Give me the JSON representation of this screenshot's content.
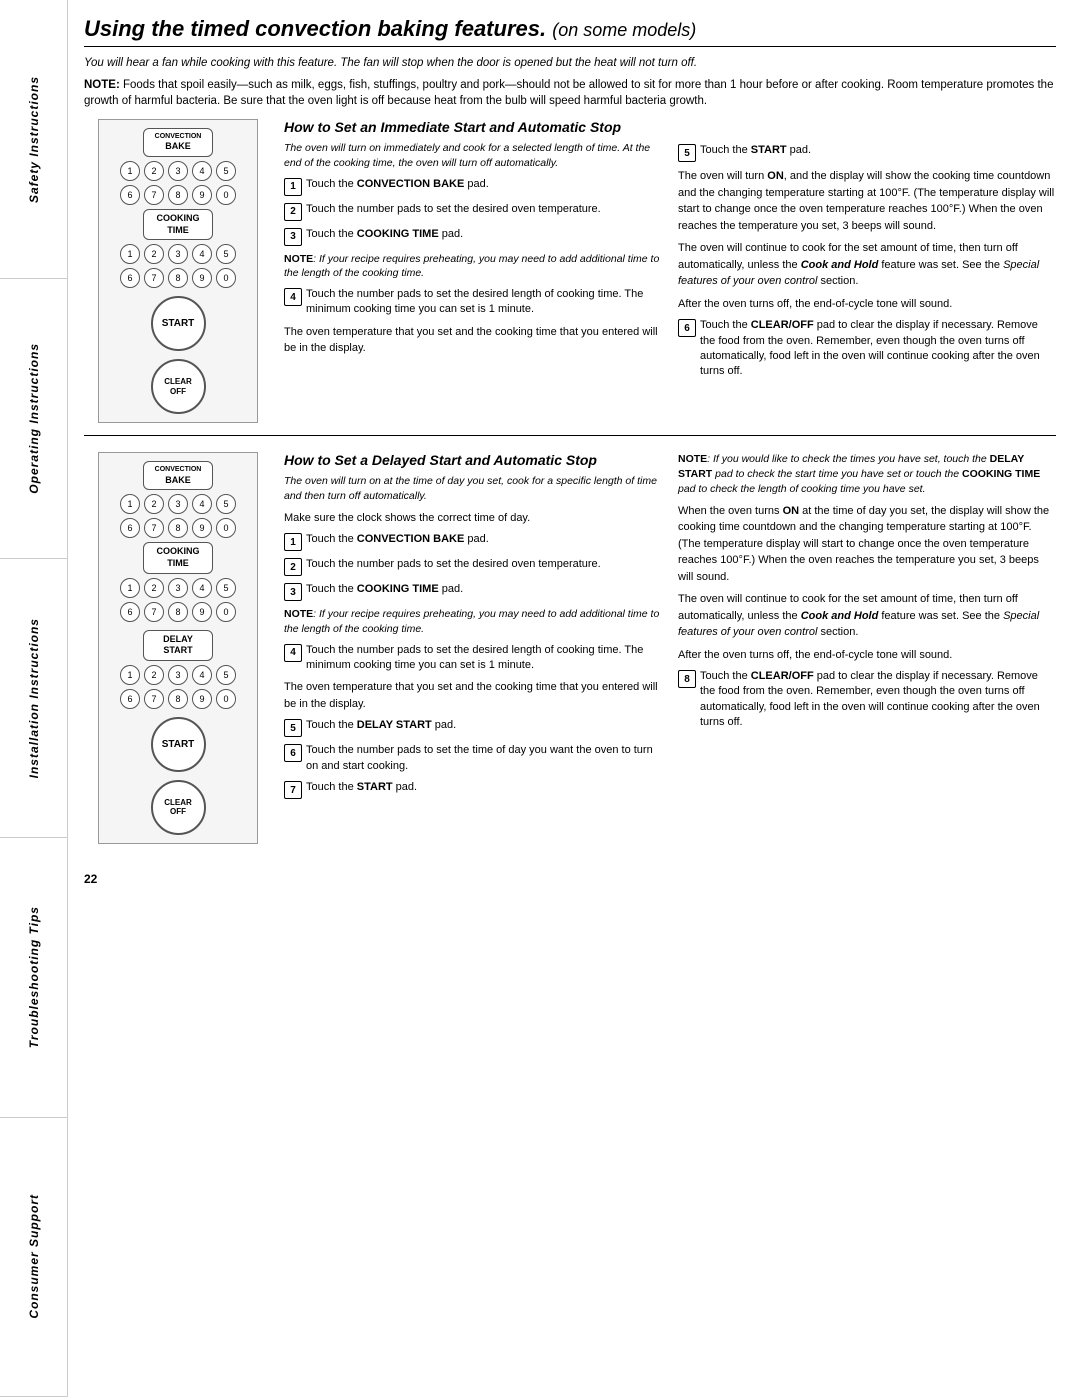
{
  "sidebar": {
    "sections": [
      {
        "label": "Safety Instructions"
      },
      {
        "label": "Operating Instructions"
      },
      {
        "label": "Installation Instructions"
      },
      {
        "label": "Troubleshooting Tips"
      },
      {
        "label": "Consumer Support"
      }
    ]
  },
  "page": {
    "title": "Using the timed convection baking features.",
    "subtitle": "(on some models)",
    "intro": "You will hear a fan while cooking with this feature. The fan will stop when the door is opened but the heat will not turn off.",
    "note": "NOTE: Foods that spoil easily—such as milk, eggs, fish, stuffings, poultry and pork—should not be allowed to sit for more than 1 hour before or after cooking. Room temperature promotes the growth of harmful bacteria. Be sure that the oven light is off because heat from the bulb will speed harmful bacteria growth.",
    "page_number": "22"
  },
  "section1": {
    "heading": "How to Set an Immediate Start and Automatic Stop",
    "italic_intro": "The oven will turn on immediately and cook for a selected length of time. At the end of the cooking time, the oven will turn off automatically.",
    "steps_left": [
      {
        "num": "1",
        "text": "Touch the CONVECTION BAKE pad."
      },
      {
        "num": "2",
        "text": "Touch the number pads to set the desired oven temperature."
      },
      {
        "num": "3",
        "text": "Touch the COOKING TIME pad."
      },
      {
        "num": "4",
        "text": "Touch the number pads to set the desired length of cooking time. The minimum cooking time you can set is 1 minute."
      }
    ],
    "note_left": "NOTE: If your recipe requires preheating, you may need to add additional time to the length of the cooking time.",
    "display_text": "The oven temperature that you set and the cooking time that you entered will be in the display.",
    "steps_right": [
      {
        "num": "5",
        "text": "Touch the START pad."
      }
    ],
    "body_right": [
      "The oven will turn ON, and the display will show the cooking time countdown and the changing temperature starting at 100°F. (The temperature display will start to change once the oven temperature reaches 100°F.) When the oven reaches the temperature you set, 3 beeps will sound.",
      "The oven will continue to cook for the set amount of time, then turn off automatically, unless the Cook and Hold feature was set. See the Special features of your oven control section.",
      "After the oven turns off, the end-of-cycle tone will sound."
    ],
    "step6": {
      "num": "6",
      "text": "Touch the CLEAR/OFF pad to clear the display if necessary. Remove the food from the oven. Remember, even though the oven turns off automatically, food left in the oven will continue cooking after the oven turns off."
    },
    "panel": {
      "buttons": [
        "CONVECTION BAKE",
        "COOKING TIME",
        "START",
        "CLEAR OFF"
      ],
      "num_rows": [
        [
          "1",
          "2",
          "3",
          "4",
          "5"
        ],
        [
          "6",
          "7",
          "8",
          "9",
          "0"
        ]
      ]
    }
  },
  "section2": {
    "heading": "How to Set a Delayed Start and Automatic Stop",
    "italic_intro": "The oven will turn on at the time of day you set, cook for a specific length of time and then turn off automatically.",
    "steps_left": [
      {
        "num": "1",
        "text": "Touch the CONVECTION BAKE pad."
      },
      {
        "num": "2",
        "text": "Touch the number pads to set the desired oven temperature."
      },
      {
        "num": "3",
        "text": "Touch the COOKING TIME pad."
      },
      {
        "num": "4",
        "text": "Touch the number pads to set the desired length of cooking time. The minimum cooking time you can set is 1 minute."
      },
      {
        "num": "5",
        "text": "Touch the DELAY START pad."
      },
      {
        "num": "6",
        "text": "Touch the number pads to set the time of day you want the oven to turn on and start cooking."
      },
      {
        "num": "7",
        "text": "Touch the START pad."
      }
    ],
    "note_left": "NOTE: If your recipe requires preheating, you may need to add additional time to the length of the cooking time.",
    "display_text": "The oven temperature that you set and the cooking time that you entered will be in the display.",
    "make_sure": "Make sure the clock shows the correct time of day.",
    "note_right": "NOTE: If you would like to check the times you have set, touch the DELAY START pad to check the start time you have set or touch the COOKING TIME pad to check the length of cooking time you have set.",
    "body_right": [
      "When the oven turns ON at the time of day you set, the display will show the cooking time countdown and the changing temperature starting at 100°F. (The temperature display will start to change once the oven temperature reaches 100°F.) When the oven reaches the temperature you set, 3 beeps will sound.",
      "The oven will continue to cook for the set amount of time, then turn off automatically, unless the Cook and Hold feature was set. See the Special features of your oven control section.",
      "After the oven turns off, the end-of-cycle tone will sound."
    ],
    "step8": {
      "num": "8",
      "text": "Touch the CLEAR/OFF pad to clear the display if necessary. Remove the food from the oven. Remember, even though the oven turns off automatically, food left in the oven will continue cooking after the oven turns off."
    },
    "panel": {
      "buttons": [
        "CONVECTION BAKE",
        "COOKING TIME",
        "DELAY START",
        "START",
        "CLEAR OFF"
      ],
      "num_rows": [
        [
          "1",
          "2",
          "3",
          "4",
          "5"
        ],
        [
          "6",
          "7",
          "8",
          "9",
          "0"
        ]
      ]
    }
  }
}
